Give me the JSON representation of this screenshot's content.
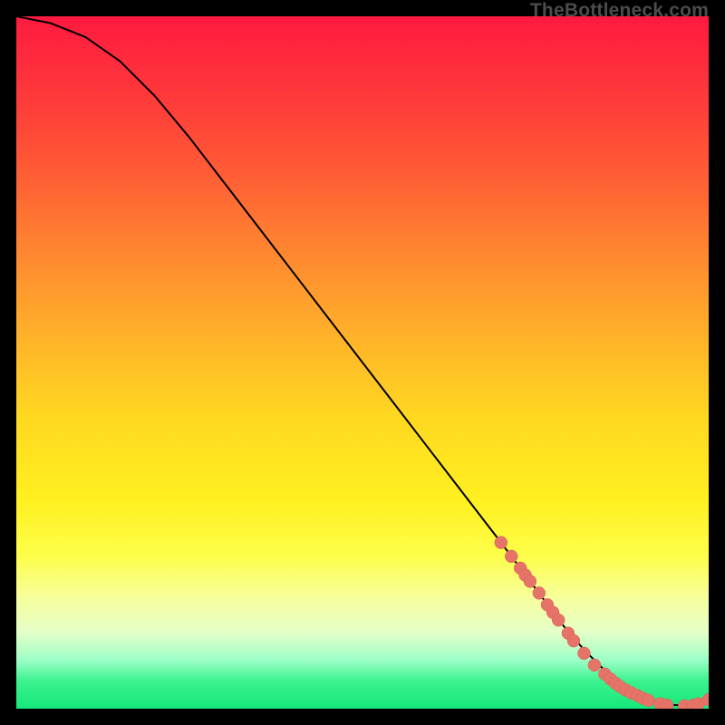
{
  "watermark": "TheBottleneck.com",
  "colors": {
    "marker_fill": "#e57368",
    "marker_stroke": "#d96458",
    "curve_stroke": "#000000"
  },
  "chart_data": {
    "type": "line",
    "title": "",
    "xlabel": "",
    "ylabel": "",
    "xlim": [
      0,
      100
    ],
    "ylim": [
      0,
      100
    ],
    "grid": false,
    "series": [
      {
        "name": "bottleneck-curve",
        "x": [
          0,
          5,
          10,
          15,
          20,
          25,
          30,
          35,
          40,
          45,
          50,
          55,
          60,
          65,
          70,
          73,
          76,
          79,
          82,
          85,
          88,
          91,
          94,
          97,
          100
        ],
        "y": [
          100,
          99,
          97,
          93.5,
          88.5,
          82.5,
          76,
          69.5,
          63,
          56.5,
          50,
          43.5,
          37,
          30.5,
          24,
          20,
          16,
          12,
          8.5,
          5.5,
          3.2,
          1.6,
          0.6,
          0.4,
          1.0
        ]
      }
    ],
    "markers": [
      {
        "x": 70.0,
        "y": 24.0
      },
      {
        "x": 71.5,
        "y": 22.0
      },
      {
        "x": 72.8,
        "y": 20.3
      },
      {
        "x": 73.5,
        "y": 19.3
      },
      {
        "x": 74.2,
        "y": 18.4
      },
      {
        "x": 75.5,
        "y": 16.7
      },
      {
        "x": 76.7,
        "y": 15.0
      },
      {
        "x": 77.5,
        "y": 13.9
      },
      {
        "x": 78.3,
        "y": 12.8
      },
      {
        "x": 79.7,
        "y": 10.9
      },
      {
        "x": 80.5,
        "y": 9.8
      },
      {
        "x": 82.0,
        "y": 8.0
      },
      {
        "x": 83.5,
        "y": 6.3
      },
      {
        "x": 85.0,
        "y": 5.0
      },
      {
        "x": 85.8,
        "y": 4.3
      },
      {
        "x": 86.5,
        "y": 3.7
      },
      {
        "x": 87.2,
        "y": 3.2
      },
      {
        "x": 88.0,
        "y": 2.7
      },
      {
        "x": 88.8,
        "y": 2.3
      },
      {
        "x": 89.7,
        "y": 1.9
      },
      {
        "x": 90.5,
        "y": 1.5
      },
      {
        "x": 91.3,
        "y": 1.2
      },
      {
        "x": 93.0,
        "y": 0.7
      },
      {
        "x": 94.0,
        "y": 0.5
      },
      {
        "x": 96.5,
        "y": 0.4
      },
      {
        "x": 97.8,
        "y": 0.5
      },
      {
        "x": 98.5,
        "y": 0.7
      },
      {
        "x": 100.0,
        "y": 1.3
      }
    ],
    "marker_radius_px": 7
  }
}
